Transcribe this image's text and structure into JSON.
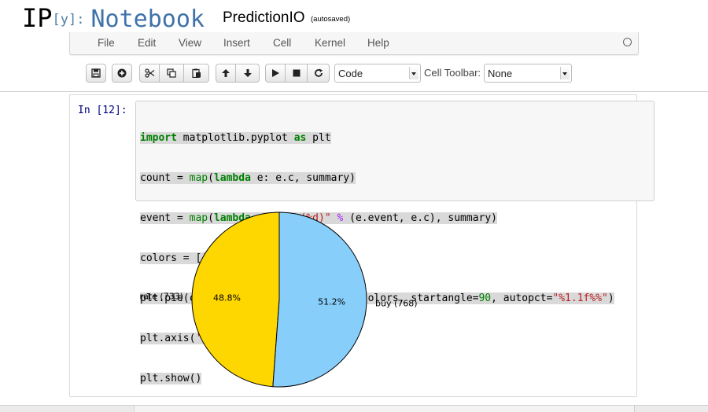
{
  "header": {
    "logo_ip": "IP",
    "logo_y": "[y]:",
    "logo_notebook": "Notebook",
    "notebook_name": "PredictionIO",
    "autosave_status": "(autosaved)"
  },
  "menu": {
    "items": [
      "File",
      "Edit",
      "View",
      "Insert",
      "Cell",
      "Kernel",
      "Help"
    ]
  },
  "toolbar": {
    "buttons": [
      "save-icon",
      "insert-cell-icon",
      "cut-icon",
      "copy-icon",
      "paste-icon",
      "move-up-icon",
      "move-down-icon",
      "run-icon",
      "stop-icon",
      "restart-icon"
    ],
    "cell_type_value": "Code",
    "cell_toolbar_label": "Cell Toolbar:",
    "cell_toolbar_value": "None"
  },
  "cell": {
    "prompt": "In [12]:",
    "code_lines": [
      "import matplotlib.pyplot as plt",
      "count = map(lambda e: e.c, summary)",
      "event = map(lambda e: \"%s (%d)\" % (e.event, e.c), summary)",
      "colors = ['gold', 'lightskyblue']",
      "plt.pie(count, labels=event, colors=colors, startangle=90, autopct=\"%1.1f%%\")",
      "plt.axis('equal')",
      "plt.show()"
    ]
  },
  "chart_data": {
    "type": "pie",
    "startangle": 90,
    "slices": [
      {
        "label": "rate (733)",
        "value": 733,
        "pct": "48.8%",
        "color": "#ffd700"
      },
      {
        "label": "buy (768)",
        "value": 768,
        "pct": "51.2%",
        "color": "#87cefa"
      }
    ]
  }
}
